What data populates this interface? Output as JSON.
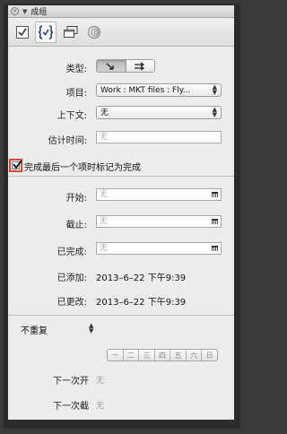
{
  "window": {
    "title": "成组"
  },
  "toolbar": {
    "tabs": [
      {
        "name": "checkbox-tab",
        "icon": "checkbox-icon"
      },
      {
        "name": "braces-tab",
        "icon": "braces-check-icon",
        "active": true
      },
      {
        "name": "windows-tab",
        "icon": "stacked-windows-icon"
      },
      {
        "name": "spiral-tab",
        "icon": "spiral-icon"
      }
    ]
  },
  "form": {
    "type_label": "类型:",
    "project_label": "项目:",
    "project_value": "Work : MKT files : Fly...",
    "context_label": "上下文:",
    "context_value": "无",
    "estimate_label": "估计时间:",
    "estimate_placeholder": "无",
    "complete_checkbox_label": "完成最后一个项时标记为完成",
    "start_label": "开始:",
    "start_placeholder": "无",
    "due_label": "截止:",
    "due_placeholder": "无",
    "completed_label": "已完成:",
    "completed_placeholder": "无",
    "added_label": "已添加:",
    "added_value": "2013–6–22 下午9:39",
    "modified_label": "已更改:",
    "modified_value": "2013–6–22 下午9:39"
  },
  "repeat": {
    "mode_value": "不重复",
    "weekdays": [
      "一",
      "二",
      "三",
      "四",
      "五",
      "六",
      "日"
    ],
    "next_start_label": "下一次开",
    "next_start_value": "无",
    "next_due_label": "下一次截",
    "next_due_value": "无"
  },
  "colors": {
    "highlight_border": "#e0463a",
    "panel_bg": "#ececec"
  }
}
